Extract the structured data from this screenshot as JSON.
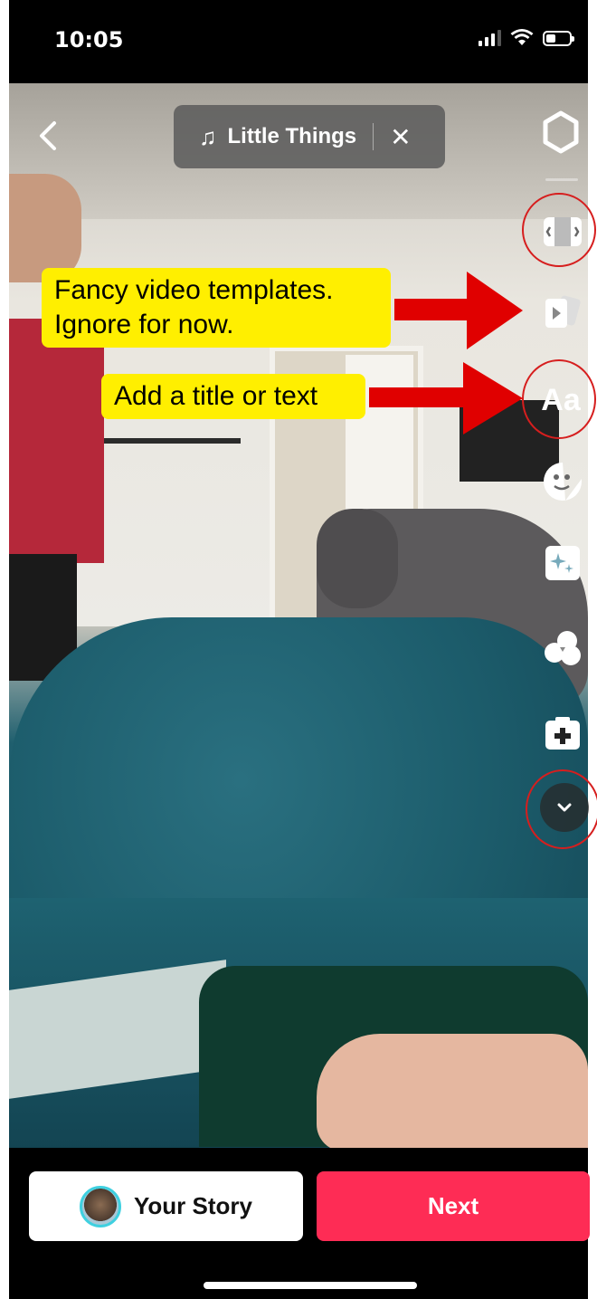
{
  "status_bar": {
    "time": "10:05"
  },
  "top_bar": {
    "back_icon": "chevron-left-icon",
    "music": {
      "icon": "music-note-icon",
      "title": "Little Things",
      "close_icon": "close-icon"
    }
  },
  "toolbar": {
    "items": [
      {
        "name": "settings",
        "icon": "gear-icon"
      },
      {
        "name": "templates",
        "icon": "templates-icon"
      },
      {
        "name": "cards",
        "icon": "cards-icon"
      },
      {
        "name": "text",
        "icon": "text-icon",
        "label": "Aa"
      },
      {
        "name": "stickers",
        "icon": "sticker-icon"
      },
      {
        "name": "effects",
        "icon": "sparkle-icon"
      },
      {
        "name": "filters",
        "icon": "filters-icon"
      },
      {
        "name": "add",
        "icon": "add-clip-icon"
      },
      {
        "name": "more",
        "icon": "chevron-down-icon"
      }
    ]
  },
  "annotations": {
    "callout_1": {
      "line_1": "Fancy video templates.",
      "line_2": "Ignore for now."
    },
    "callout_2": {
      "text": "Add a title or text"
    },
    "highlight_color": "#ffef00",
    "arrow_color": "#e00000"
  },
  "bottom_bar": {
    "story_label": "Your Story",
    "next_label": "Next",
    "next_color": "#fe2c55"
  }
}
